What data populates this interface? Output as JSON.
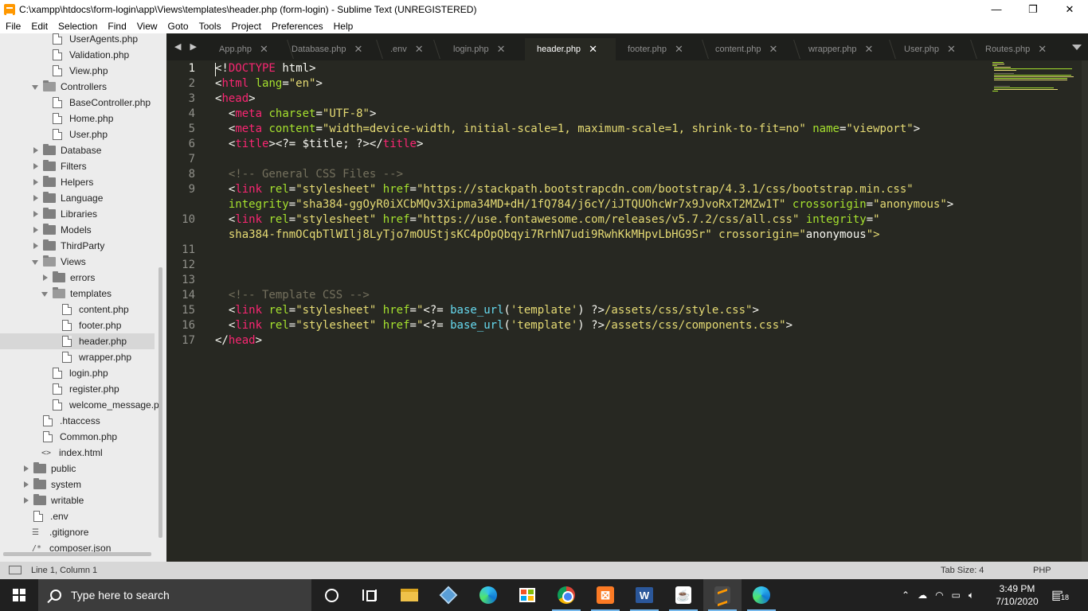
{
  "window": {
    "title": "C:\\xampp\\htdocs\\form-login\\app\\Views\\templates\\header.php (form-login) - Sublime Text (UNREGISTERED)",
    "minimize": "—",
    "maximize": "❐",
    "close": "✕"
  },
  "menu": [
    "File",
    "Edit",
    "Selection",
    "Find",
    "View",
    "Goto",
    "Tools",
    "Project",
    "Preferences",
    "Help"
  ],
  "sidebar": {
    "items": [
      {
        "label": "UserAgents.php",
        "type": "file"
      },
      {
        "label": "Validation.php",
        "type": "file"
      },
      {
        "label": "View.php",
        "type": "file"
      },
      {
        "label": "Controllers",
        "type": "folder-open"
      },
      {
        "label": "BaseController.php",
        "type": "file"
      },
      {
        "label": "Home.php",
        "type": "file"
      },
      {
        "label": "User.php",
        "type": "file"
      },
      {
        "label": "Database",
        "type": "folder"
      },
      {
        "label": "Filters",
        "type": "folder"
      },
      {
        "label": "Helpers",
        "type": "folder"
      },
      {
        "label": "Language",
        "type": "folder"
      },
      {
        "label": "Libraries",
        "type": "folder"
      },
      {
        "label": "Models",
        "type": "folder"
      },
      {
        "label": "ThirdParty",
        "type": "folder"
      },
      {
        "label": "Views",
        "type": "folder-open"
      },
      {
        "label": "errors",
        "type": "folder"
      },
      {
        "label": "templates",
        "type": "folder-open"
      },
      {
        "label": "content.php",
        "type": "file"
      },
      {
        "label": "footer.php",
        "type": "file"
      },
      {
        "label": "header.php",
        "type": "file",
        "selected": true
      },
      {
        "label": "wrapper.php",
        "type": "file"
      },
      {
        "label": "login.php",
        "type": "file"
      },
      {
        "label": "register.php",
        "type": "file"
      },
      {
        "label": "welcome_message.p",
        "type": "file"
      },
      {
        "label": ".htaccess",
        "type": "file"
      },
      {
        "label": "Common.php",
        "type": "file"
      },
      {
        "label": "index.html",
        "type": "code"
      },
      {
        "label": "public",
        "type": "folder"
      },
      {
        "label": "system",
        "type": "folder"
      },
      {
        "label": "writable",
        "type": "folder"
      },
      {
        "label": ".env",
        "type": "file"
      },
      {
        "label": ".gitignore",
        "type": "lines"
      },
      {
        "label": "composer.json",
        "type": "code"
      }
    ]
  },
  "tabs": [
    {
      "label": "App.php"
    },
    {
      "label": "Database.php"
    },
    {
      "label": ".env"
    },
    {
      "label": "login.php"
    },
    {
      "label": "header.php",
      "active": true
    },
    {
      "label": "footer.php"
    },
    {
      "label": "content.php"
    },
    {
      "label": "wrapper.php"
    },
    {
      "label": "User.php"
    },
    {
      "label": "Routes.php"
    }
  ],
  "tab_close_glyph": "✕",
  "tab_nav": "◀ ▶",
  "editor": {
    "gutter": [
      "1",
      "2",
      "3",
      "4",
      "5",
      "6",
      "7",
      "8",
      "9",
      "",
      "10",
      "",
      "11",
      "12",
      "13",
      "14",
      "15",
      "16",
      "17"
    ],
    "lines": [
      "<!DOCTYPE html>",
      "<html lang=\"en\">",
      "<head>",
      "  <meta charset=\"UTF-8\">",
      "  <meta content=\"width=device-width, initial-scale=1, maximum-scale=1, shrink-to-fit=no\" name=\"viewport\">",
      "  <title><?= $title; ?></title>",
      "",
      "  <!-- General CSS Files -->",
      "  <link rel=\"stylesheet\" href=\"https://stackpath.bootstrapcdn.com/bootstrap/4.3.1/css/bootstrap.min.css\"",
      "  integrity=\"sha384-ggOyR0iXCbMQv3Xipma34MD+dH/1fQ784/j6cY/iJTQUOhcWr7x9JvoRxT2MZw1T\" crossorigin=\"anonymous\">",
      "  <link rel=\"stylesheet\" href=\"https://use.fontawesome.com/releases/v5.7.2/css/all.css\" integrity=\"",
      "  sha384-fnmOCqbTlWIlj8LyTjo7mOUStjsKC4pOpQbqyi7RrhN7udi9RwhKkMHpvLbHG9Sr\" crossorigin=\"anonymous\">",
      "",
      "",
      "",
      "  <!-- Template CSS -->",
      "  <link rel=\"stylesheet\" href=\"<?= base_url('template') ?>/assets/css/style.css\">",
      "  <link rel=\"stylesheet\" href=\"<?= base_url('template') ?>/assets/css/components.css\">",
      "</head>"
    ]
  },
  "status": {
    "position": "Line 1, Column 1",
    "tab_size": "Tab Size: 4",
    "syntax": "PHP"
  },
  "taskbar": {
    "search_placeholder": "Type here to search",
    "apps": [
      "cortana-icon",
      "task-view-icon",
      "file-explorer-icon",
      "virtualbox-icon",
      "edge-icon",
      "store-icon",
      "chrome-icon",
      "xampp-icon",
      "word-icon",
      "java-icon",
      "sublime-icon",
      "edge-beta-icon"
    ],
    "time": "3:49 PM",
    "date": "7/10/2020",
    "notifications": "18"
  }
}
